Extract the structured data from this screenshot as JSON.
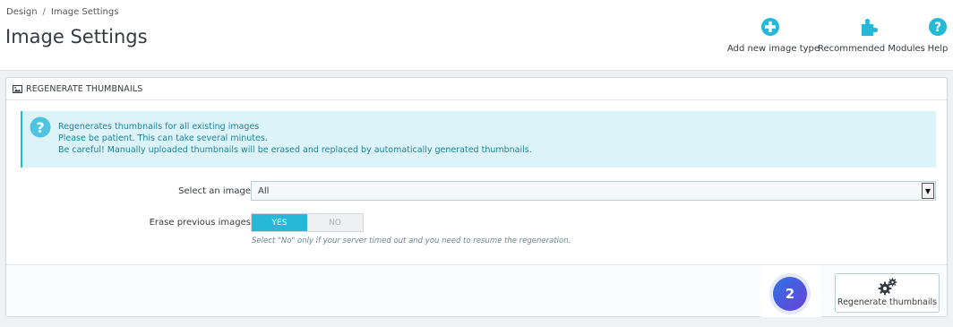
{
  "breadcrumb": {
    "parent": "Design",
    "separator": "/",
    "current": "Image Settings"
  },
  "page_title": "Image Settings",
  "toolbar": {
    "add_label": "Add new image type",
    "modules_label": "Recommended Modules",
    "help_label": "Help"
  },
  "panel": {
    "heading": "REGENERATE THUMBNAILS",
    "alert_lines": [
      "Regenerates thumbnails for all existing images",
      "Please be patient. This can take several minutes.",
      "Be careful! Manually uploaded thumbnails will be erased and replaced by automatically generated thumbnails."
    ],
    "select_label": "Select an image",
    "select_value": "All",
    "erase_label": "Erase previous images",
    "switch_yes": "YES",
    "switch_no": "NO",
    "erase_selected": "YES",
    "help_text": "Select \"No\" only if your server timed out and you need to resume the regeneration.",
    "regenerate_label": "Regenerate thumbnails"
  },
  "badge_number": "2",
  "colors": {
    "accent": "#25b9d7",
    "alert_bg": "#dcf4f9",
    "alert_text": "#1f8399",
    "badge": "#3d63e0"
  },
  "icons": {
    "add": "plus-circle-icon",
    "modules": "puzzle-icon",
    "help": "question-circle-icon",
    "panel": "picture-icon",
    "alert": "question-circle-icon",
    "regenerate": "gears-icon",
    "select": "chevron-down-icon"
  }
}
